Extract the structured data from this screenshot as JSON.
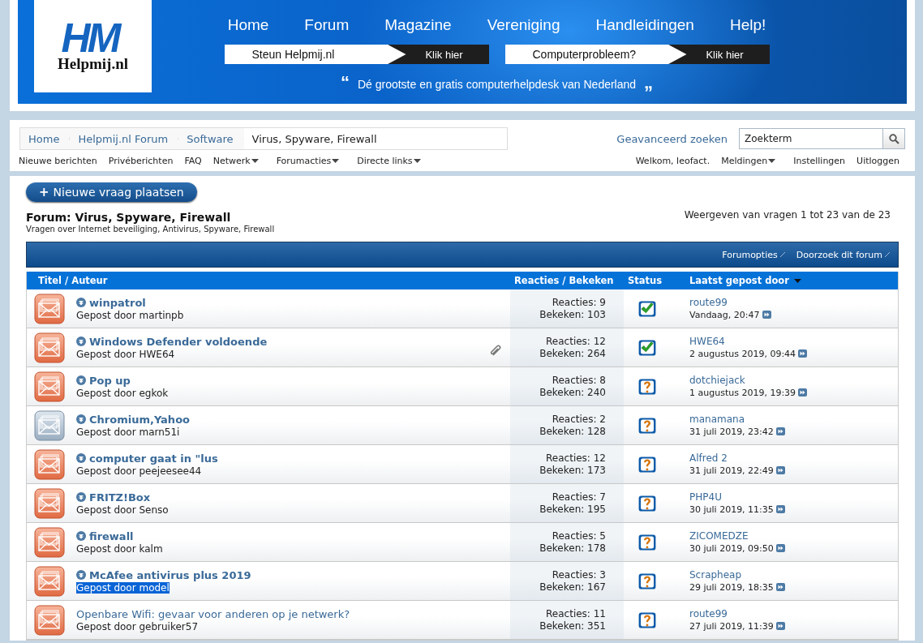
{
  "header": {
    "logo": {
      "mark": "HM",
      "name": "Helpmij.nl"
    },
    "nav": [
      "Home",
      "Forum",
      "Magazine",
      "Vereniging",
      "Handleidingen",
      "Help!"
    ],
    "banners": [
      {
        "label": "Steun Helpmij.nl",
        "action": "Klik hier"
      },
      {
        "label": "Computerprobleem?",
        "action": "Klik hier"
      }
    ],
    "tagline": {
      "open": "“",
      "text": "Dé grootste en gratis computerhelpdesk van Nederland",
      "close": "„"
    }
  },
  "navbar": {
    "breadcrumbs": [
      {
        "label": "Home",
        "current": false
      },
      {
        "label": "Helpmij.nl Forum",
        "current": false
      },
      {
        "label": "Software",
        "current": false
      },
      {
        "label": "Virus, Spyware, Firewall",
        "current": true
      }
    ],
    "advanced_search": "Geavanceerd zoeken",
    "search": {
      "placeholder": "Zoekterm"
    },
    "links": [
      {
        "label": "Nieuwe berichten",
        "dropdown": false
      },
      {
        "label": "Privéberichten",
        "dropdown": false
      },
      {
        "label": "FAQ",
        "dropdown": false
      },
      {
        "label": "Netwerk",
        "dropdown": true
      },
      {
        "label": "Forumacties",
        "dropdown": true
      },
      {
        "label": "Directe links",
        "dropdown": true
      }
    ],
    "welcome": "Welkom, leofact.",
    "user_links": [
      {
        "label": "Meldingen",
        "dropdown": true
      },
      {
        "label": "Instellingen",
        "dropdown": false
      },
      {
        "label": "Uitloggen",
        "dropdown": false
      }
    ]
  },
  "forum": {
    "new_button": {
      "icon": "+",
      "label": "Nieuwe vraag plaatsen"
    },
    "title": "Forum: Virus, Spyware, Firewall",
    "description": "Vragen over Internet beveiliging, Antivirus, Spyware, Firewall",
    "pagination": "Weergeven van vragen 1 tot 23 van de 23",
    "tools": [
      "Forumopties",
      "Doorzoek dit forum"
    ],
    "columns": [
      {
        "label": "Titel / Auteur",
        "sorted": false
      },
      {
        "label": "Reacties / Bekeken",
        "sorted": false
      },
      {
        "label": "Status",
        "sorted": false
      },
      {
        "label": "Laatst gepost door",
        "sorted": true
      }
    ]
  },
  "threads": [
    {
      "title": "winpatrol",
      "author": "Gepost door martinpb",
      "unread": true,
      "new_posts": true,
      "attachment": false,
      "highlighted": false,
      "replies": "Reacties: 9",
      "views": "Bekeken: 103",
      "solved": true,
      "last_user": "route99",
      "last_date": "Vandaag, 20:47"
    },
    {
      "title": "Windows Defender voldoende",
      "author": "Gepost door HWE64",
      "unread": true,
      "new_posts": true,
      "attachment": true,
      "highlighted": false,
      "replies": "Reacties: 12",
      "views": "Bekeken: 264",
      "solved": true,
      "last_user": "HWE64",
      "last_date": "2 augustus 2019, 09:44"
    },
    {
      "title": "Pop up",
      "author": "Gepost door egkok",
      "unread": true,
      "new_posts": true,
      "attachment": false,
      "highlighted": false,
      "replies": "Reacties: 8",
      "views": "Bekeken: 240",
      "solved": false,
      "last_user": "dotchiejack",
      "last_date": "1 augustus 2019, 19:39"
    },
    {
      "title": "Chromium,Yahoo",
      "author": "Gepost door marn51i",
      "unread": true,
      "new_posts": false,
      "attachment": false,
      "highlighted": false,
      "replies": "Reacties: 2",
      "views": "Bekeken: 128",
      "solved": false,
      "last_user": "manamana",
      "last_date": "31 juli 2019, 23:42"
    },
    {
      "title": "computer gaat in \"lus",
      "author": "Gepost door peejeesee44",
      "unread": true,
      "new_posts": true,
      "attachment": false,
      "highlighted": false,
      "replies": "Reacties: 12",
      "views": "Bekeken: 173",
      "solved": false,
      "last_user": "Alfred 2",
      "last_date": "31 juli 2019, 22:49"
    },
    {
      "title": "FRITZ!Box",
      "author": "Gepost door Senso",
      "unread": true,
      "new_posts": true,
      "attachment": false,
      "highlighted": false,
      "replies": "Reacties: 7",
      "views": "Bekeken: 195",
      "solved": false,
      "last_user": "PHP4U",
      "last_date": "30 juli 2019, 11:35"
    },
    {
      "title": "firewall",
      "author": "Gepost door kalm",
      "unread": true,
      "new_posts": true,
      "attachment": false,
      "highlighted": false,
      "replies": "Reacties: 5",
      "views": "Bekeken: 178",
      "solved": false,
      "last_user": "ZICOMEDZE",
      "last_date": "30 juli 2019, 09:50"
    },
    {
      "title": "McAfee antivirus plus 2019",
      "author": "Gepost door model",
      "unread": true,
      "new_posts": true,
      "attachment": false,
      "highlighted": true,
      "replies": "Reacties: 3",
      "views": "Bekeken: 167",
      "solved": false,
      "last_user": "Scrapheap",
      "last_date": "29 juli 2019, 18:35"
    },
    {
      "title": "Openbare Wifi: gevaar voor anderen op je netwerk?",
      "author": "Gepost door gebruiker57",
      "unread": false,
      "new_posts": true,
      "attachment": false,
      "highlighted": false,
      "replies": "Reacties: 11",
      "views": "Bekeken: 351",
      "solved": false,
      "last_user": "route99",
      "last_date": "27 juli 2019, 11:39"
    }
  ]
}
